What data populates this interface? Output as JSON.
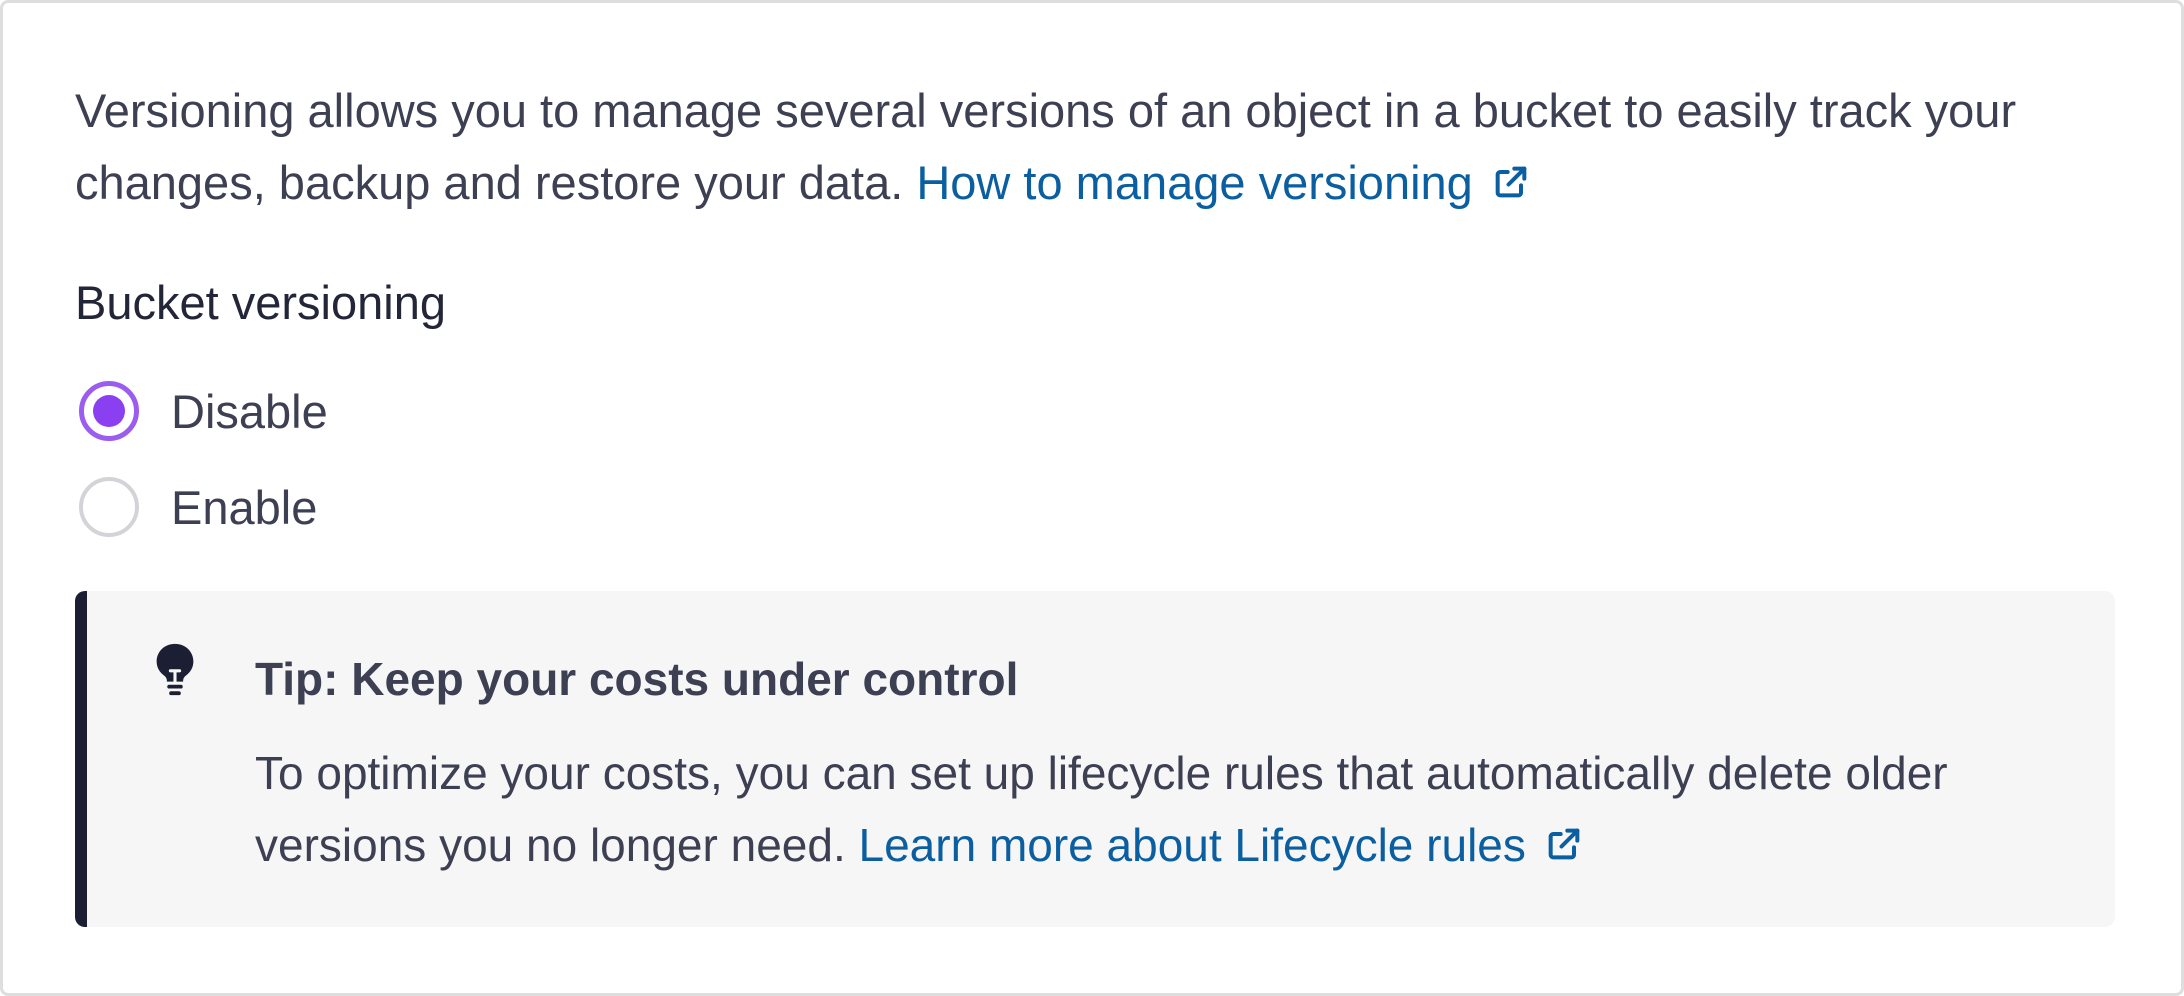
{
  "intro": {
    "text": "Versioning allows you to manage several versions of an object in a bucket to easily track your changes, backup and restore your data.",
    "link_label": "How to manage versioning"
  },
  "versioning": {
    "title": "Bucket versioning",
    "options": [
      {
        "label": "Disable",
        "selected": true
      },
      {
        "label": "Enable",
        "selected": false
      }
    ]
  },
  "tip": {
    "title": "Tip: Keep your costs under control",
    "body": "To optimize your costs, you can set up lifecycle rules that automatically delete older versions you no longer need.",
    "link_label": "Learn more about Lifecycle rules"
  },
  "icons": {
    "external_link": "external-link-icon",
    "tip": "lightbulb-icon"
  },
  "colors": {
    "link": "#0b5fa0",
    "radio_selected": "#8a3ff0",
    "tip_accent": "#1c1f33",
    "tip_background": "#f6f6f7"
  }
}
